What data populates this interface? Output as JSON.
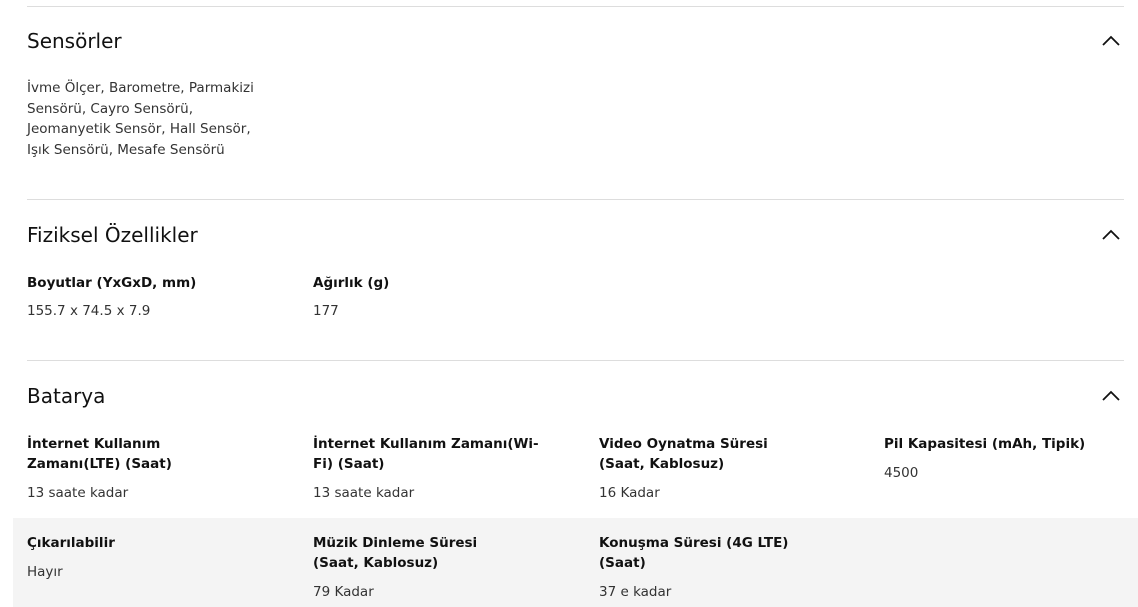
{
  "sections": {
    "sensors": {
      "title": "Sensörler",
      "text": "İvme Ölçer, Barometre, Parmakizi\nSensörü, Cayro Sensörü,\nJeomanyetik Sensör, Hall Sensör,\nIşık Sensörü, Mesafe Sensörü"
    },
    "physical": {
      "title": "Fiziksel Özellikler",
      "specs": [
        {
          "label": "Boyutlar (YxGxD, mm)",
          "value": "155.7 x 74.5 x 7.9"
        },
        {
          "label": "Ağırlık (g)",
          "value": "177"
        }
      ]
    },
    "battery": {
      "title": "Batarya",
      "specs": [
        {
          "label": "İnternet Kullanım Zamanı(LTE) (Saat)",
          "value": "13 saate kadar"
        },
        {
          "label": "İnternet Kullanım Zamanı(Wi-Fi) (Saat)",
          "value": "13 saate kadar"
        },
        {
          "label": "Video Oynatma Süresi (Saat, Kablosuz)",
          "value": "16 Kadar"
        },
        {
          "label": "Pil Kapasitesi (mAh, Tipik)",
          "value": "4500"
        },
        {
          "label": "Çıkarılabilir",
          "value": "Hayır"
        },
        {
          "label": "Müzik Dinleme Süresi (Saat, Kablosuz)",
          "value": "79 Kadar"
        },
        {
          "label": "Konuşma Süresi (4G LTE) (Saat)",
          "value": "37 e kadar"
        }
      ]
    }
  },
  "icons": {
    "collapse": "chevron-up-icon"
  },
  "colors": {
    "divider": "#dddddd",
    "band": "#f4f4f4"
  }
}
